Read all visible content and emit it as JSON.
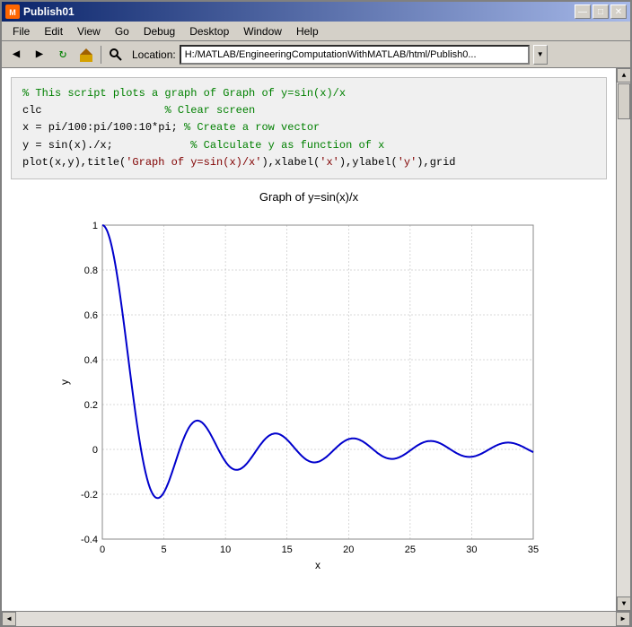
{
  "window": {
    "title": "Publish01",
    "icon": "M"
  },
  "titleButtons": {
    "minimize": "—",
    "maximize": "□",
    "close": "✕"
  },
  "menuBar": {
    "items": [
      "File",
      "Edit",
      "View",
      "Go",
      "Debug",
      "Desktop",
      "Window",
      "Help"
    ]
  },
  "toolbar": {
    "location_label": "Location:",
    "location_value": "H:/MATLAB/EngineeringComputationWithMATLAB/html/Publish0..."
  },
  "code": {
    "line1_comment": "% This script plots a graph of Graph of y=sin(x)/x",
    "line2_code": "clc",
    "line2_comment": "% Clear screen",
    "line3_code": "x = pi/100:pi/100:10*pi;",
    "line3_comment": "% Create a row vector",
    "line4_code": "y = sin(x)./x;",
    "line4_comment": "% Calculate y as function of x",
    "line5_code": "plot(x,y),title('Graph of y=sin(x)/x'),xlabel('x'),ylabel('y'),grid"
  },
  "graph": {
    "title": "Graph of y=sin(x)/x",
    "xlabel": "x",
    "ylabel": "y",
    "xmin": 0,
    "xmax": 35,
    "ymin": -0.4,
    "ymax": 1.0,
    "xticks": [
      0,
      5,
      10,
      15,
      20,
      25,
      30,
      35
    ],
    "yticks": [
      -0.4,
      -0.2,
      0,
      0.2,
      0.4,
      0.6,
      0.8,
      1
    ]
  }
}
